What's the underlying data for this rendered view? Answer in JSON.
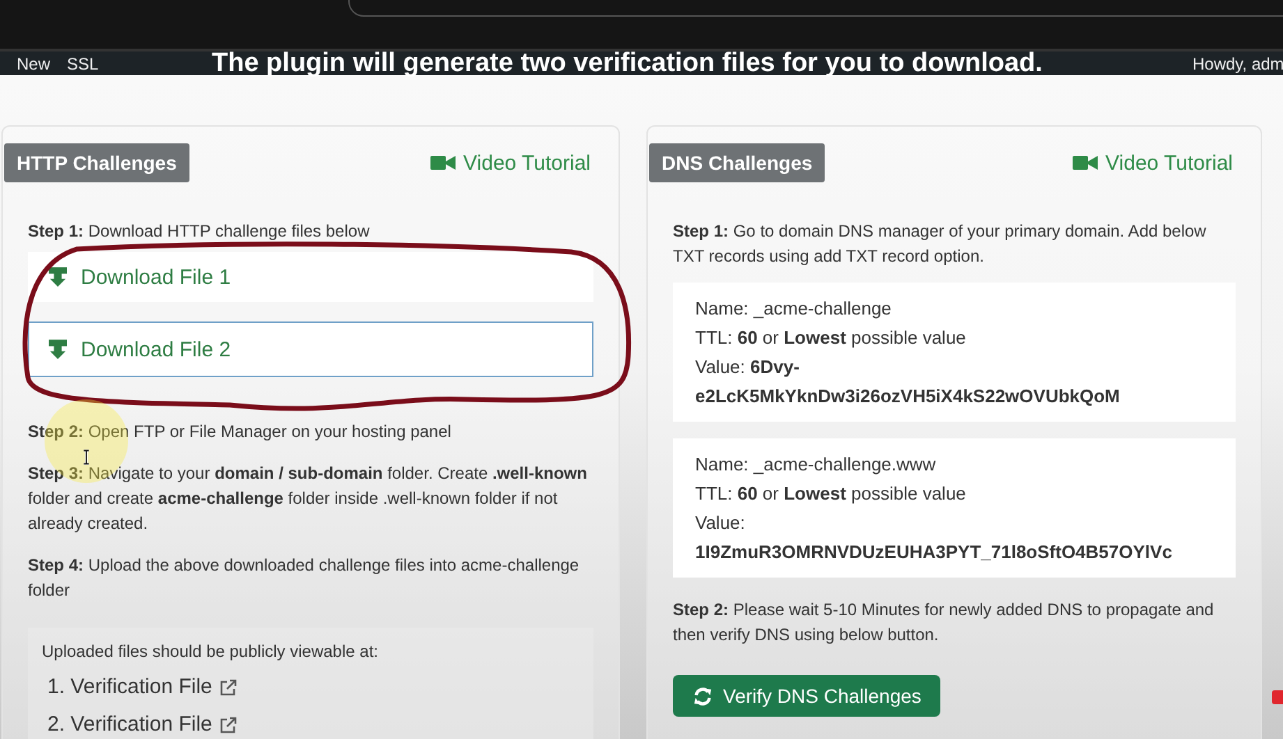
{
  "admin_bar": {
    "items": [
      "New",
      "SSL"
    ],
    "caption": "The plugin will generate two verification files for you to download.",
    "greeting": "Howdy, adm"
  },
  "panels": [
    {
      "kind": "http",
      "title": "HTTP Challenges",
      "video_link": "Video Tutorial",
      "intro": "**Step 1:** Download HTTP challenge files below",
      "downloads": [
        {
          "label": "Download File 1",
          "focused": false
        },
        {
          "label": "Download File 2",
          "focused": true
        }
      ],
      "steps": [
        "**Step 2:** Open FTP or File Manager on your hosting panel",
        "**Step 3:** Navigate to your **domain / sub-domain** folder. Create **.well-known** folder and create **acme-challenge** folder inside .well-known folder if not already created.",
        "**Step 4:** Upload the above downloaded challenge files into acme-challenge folder"
      ],
      "uploaded": {
        "heading": "Uploaded files should be publicly viewable at:",
        "links": [
          "1. Verification File",
          "2. Verification File"
        ]
      }
    },
    {
      "kind": "dns",
      "title": "DNS Challenges",
      "video_link": "Video Tutorial",
      "intro": "**Step 1:** Go to domain DNS manager of your primary domain. Add below TXT records using add TXT record option.",
      "records": [
        {
          "lines": [
            "Name: _acme-challenge",
            "TTL: **60** or **Lowest** possible value",
            "Value: **6Dvy-e2LcK5MkYknDw3i26ozVH5iX4kS22wOVUbkQoM**"
          ]
        },
        {
          "lines": [
            "Name: _acme-challenge.www",
            "TTL: **60** or **Lowest** possible value",
            "Value: **1I9ZmuR3OMRNVDUzEUHA3PYT_71l8oSftO4B57OYlVc**"
          ]
        }
      ],
      "steps": [
        "**Step 2:** Please wait 5-10 Minutes for newly added DNS to propagate and then verify DNS using below button."
      ],
      "button": "Verify DNS Challenges"
    }
  ]
}
